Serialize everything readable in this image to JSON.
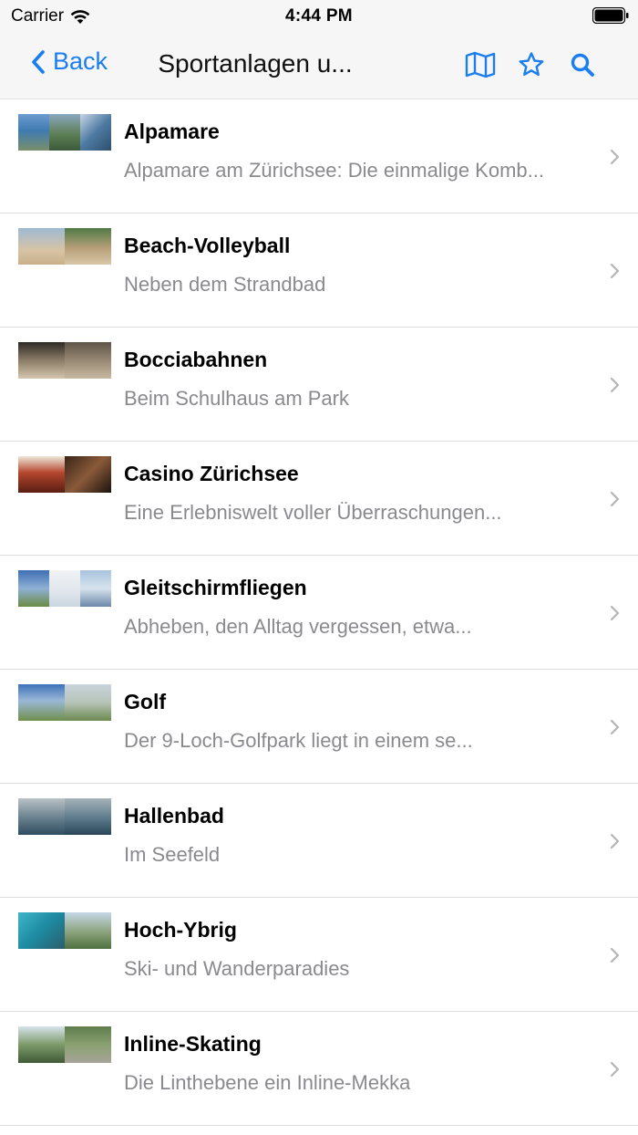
{
  "status_bar": {
    "carrier": "Carrier",
    "time": "4:44 PM"
  },
  "nav": {
    "back_label": "Back",
    "title": "Sportanlagen u...",
    "icons": [
      "map-icon",
      "star-icon",
      "search-icon"
    ],
    "accent_color": "#1a7ef0"
  },
  "items": [
    {
      "title": "Alpamare",
      "subtitle": "Alpamare am Zürichsee: Die einmalige Komb..."
    },
    {
      "title": "Beach-Volleyball",
      "subtitle": "Neben dem Strandbad"
    },
    {
      "title": "Bocciabahnen",
      "subtitle": "Beim Schulhaus am Park"
    },
    {
      "title": "Casino Zürichsee",
      "subtitle": "Eine Erlebniswelt voller Überraschungen..."
    },
    {
      "title": "Gleitschirmfliegen",
      "subtitle": "Abheben, den Alltag vergessen, etwa..."
    },
    {
      "title": "Golf",
      "subtitle": "Der 9-Loch-Golfpark liegt in einem se..."
    },
    {
      "title": "Hallenbad",
      "subtitle": "Im Seefeld"
    },
    {
      "title": "Hoch-Ybrig",
      "subtitle": "Ski- und Wanderparadies"
    },
    {
      "title": "Inline-Skating",
      "subtitle": "Die Linthebene ein Inline-Mekka"
    }
  ]
}
